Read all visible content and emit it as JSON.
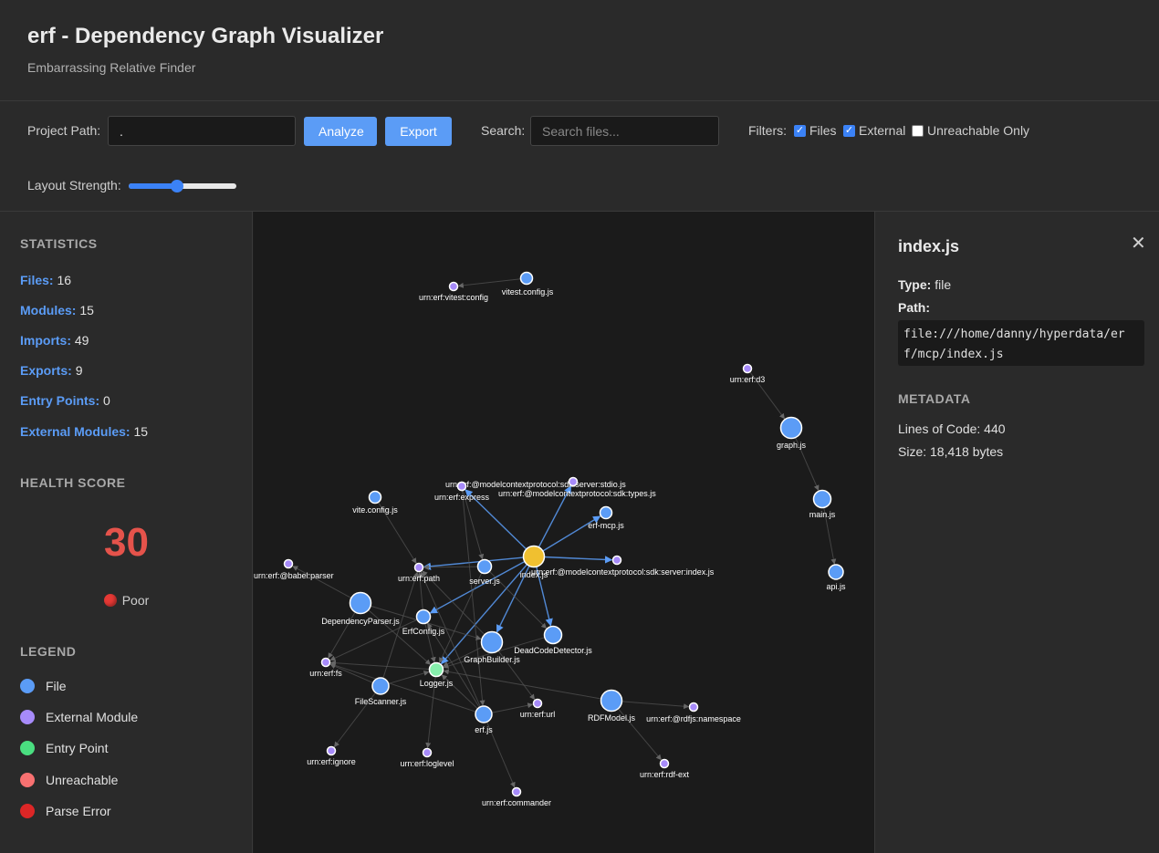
{
  "header": {
    "title": "erf - Dependency Graph Visualizer",
    "subtitle": "Embarrassing Relative Finder"
  },
  "controls": {
    "project_path_label": "Project Path:",
    "project_path_value": ".",
    "analyze_label": "Analyze",
    "export_label": "Export",
    "search_label": "Search:",
    "search_placeholder": "Search files...",
    "filters_label": "Filters:",
    "filter_files_label": "Files",
    "filter_files_checked": true,
    "filter_external_label": "External",
    "filter_external_checked": true,
    "filter_unreachable_label": "Unreachable Only",
    "filter_unreachable_checked": false,
    "layout_strength_label": "Layout Strength:",
    "layout_strength_fraction": 0.45
  },
  "sidebar": {
    "statistics_title": "STATISTICS",
    "stats": [
      {
        "key": "Files:",
        "value": "16"
      },
      {
        "key": "Modules:",
        "value": "15"
      },
      {
        "key": "Imports:",
        "value": "49"
      },
      {
        "key": "Exports:",
        "value": "9"
      },
      {
        "key": "Entry Points:",
        "value": "0"
      },
      {
        "key": "External Modules:",
        "value": "15"
      }
    ],
    "health_title": "HEALTH SCORE",
    "health_score": "30",
    "health_status": "Poor",
    "legend_title": "LEGEND",
    "legend": [
      {
        "label": "File",
        "color": "#5b9cf6"
      },
      {
        "label": "External Module",
        "color": "#a78bfa"
      },
      {
        "label": "Entry Point",
        "color": "#4ade80"
      },
      {
        "label": "Unreachable",
        "color": "#f87171"
      },
      {
        "label": "Parse Error",
        "color": "#dc2626"
      }
    ]
  },
  "graph": {
    "colors": {
      "file": "#5b9cf6",
      "external": "#a78bfa",
      "entry": "#86efac",
      "selected": "#f0c030"
    },
    "nodes": [
      {
        "id": "vitest.config.js",
        "kind": "file"
      },
      {
        "id": "urn:erf:vitest:config",
        "kind": "external"
      },
      {
        "id": "urn:erf:d3",
        "kind": "external"
      },
      {
        "id": "graph.js",
        "kind": "file"
      },
      {
        "id": "main.js",
        "kind": "file"
      },
      {
        "id": "api.js",
        "kind": "file"
      },
      {
        "id": "urn:erf:@modelcontextprotocol:sdk:server:stdio.js",
        "kind": "external"
      },
      {
        "id": "urn:erf:express",
        "kind": "external"
      },
      {
        "id": "urn:erf:@modelcontextprotocol:sdk:types.js",
        "kind": "external"
      },
      {
        "id": "vite.config.js",
        "kind": "file"
      },
      {
        "id": "erf-mcp.js",
        "kind": "file"
      },
      {
        "id": "index.js",
        "kind": "selected"
      },
      {
        "id": "urn:erf:@modelcontextprotocol:sdk:server:index.js",
        "kind": "external"
      },
      {
        "id": "urn:erf:@babel:parser",
        "kind": "external"
      },
      {
        "id": "urn:erf:path",
        "kind": "external"
      },
      {
        "id": "server.js",
        "kind": "file"
      },
      {
        "id": "DependencyParser.js",
        "kind": "file"
      },
      {
        "id": "ErfConfig.js",
        "kind": "file"
      },
      {
        "id": "GraphBuilder.js",
        "kind": "file"
      },
      {
        "id": "DeadCodeDetector.js",
        "kind": "file"
      },
      {
        "id": "urn:erf:fs",
        "kind": "external"
      },
      {
        "id": "Logger.js",
        "kind": "entry"
      },
      {
        "id": "FileScanner.js",
        "kind": "file"
      },
      {
        "id": "urn:erf:url",
        "kind": "external"
      },
      {
        "id": "erf.js",
        "kind": "file"
      },
      {
        "id": "RDFModel.js",
        "kind": "file"
      },
      {
        "id": "urn:erf:@rdfjs:namespace",
        "kind": "external"
      },
      {
        "id": "urn:erf:ignore",
        "kind": "external"
      },
      {
        "id": "urn:erf:loglevel",
        "kind": "external"
      },
      {
        "id": "urn:erf:rdf-ext",
        "kind": "external"
      },
      {
        "id": "urn:erf:commander",
        "kind": "external"
      }
    ]
  },
  "detail": {
    "title": "index.js",
    "close_icon": "close-icon",
    "type_label": "Type:",
    "type_value": "file",
    "path_label": "Path:",
    "path_value": "file:///home/danny/hyperdata/erf/mcp/index.js",
    "metadata_title": "METADATA",
    "lines_of_code": "Lines of Code: 440",
    "size": "Size: 18,418 bytes"
  }
}
